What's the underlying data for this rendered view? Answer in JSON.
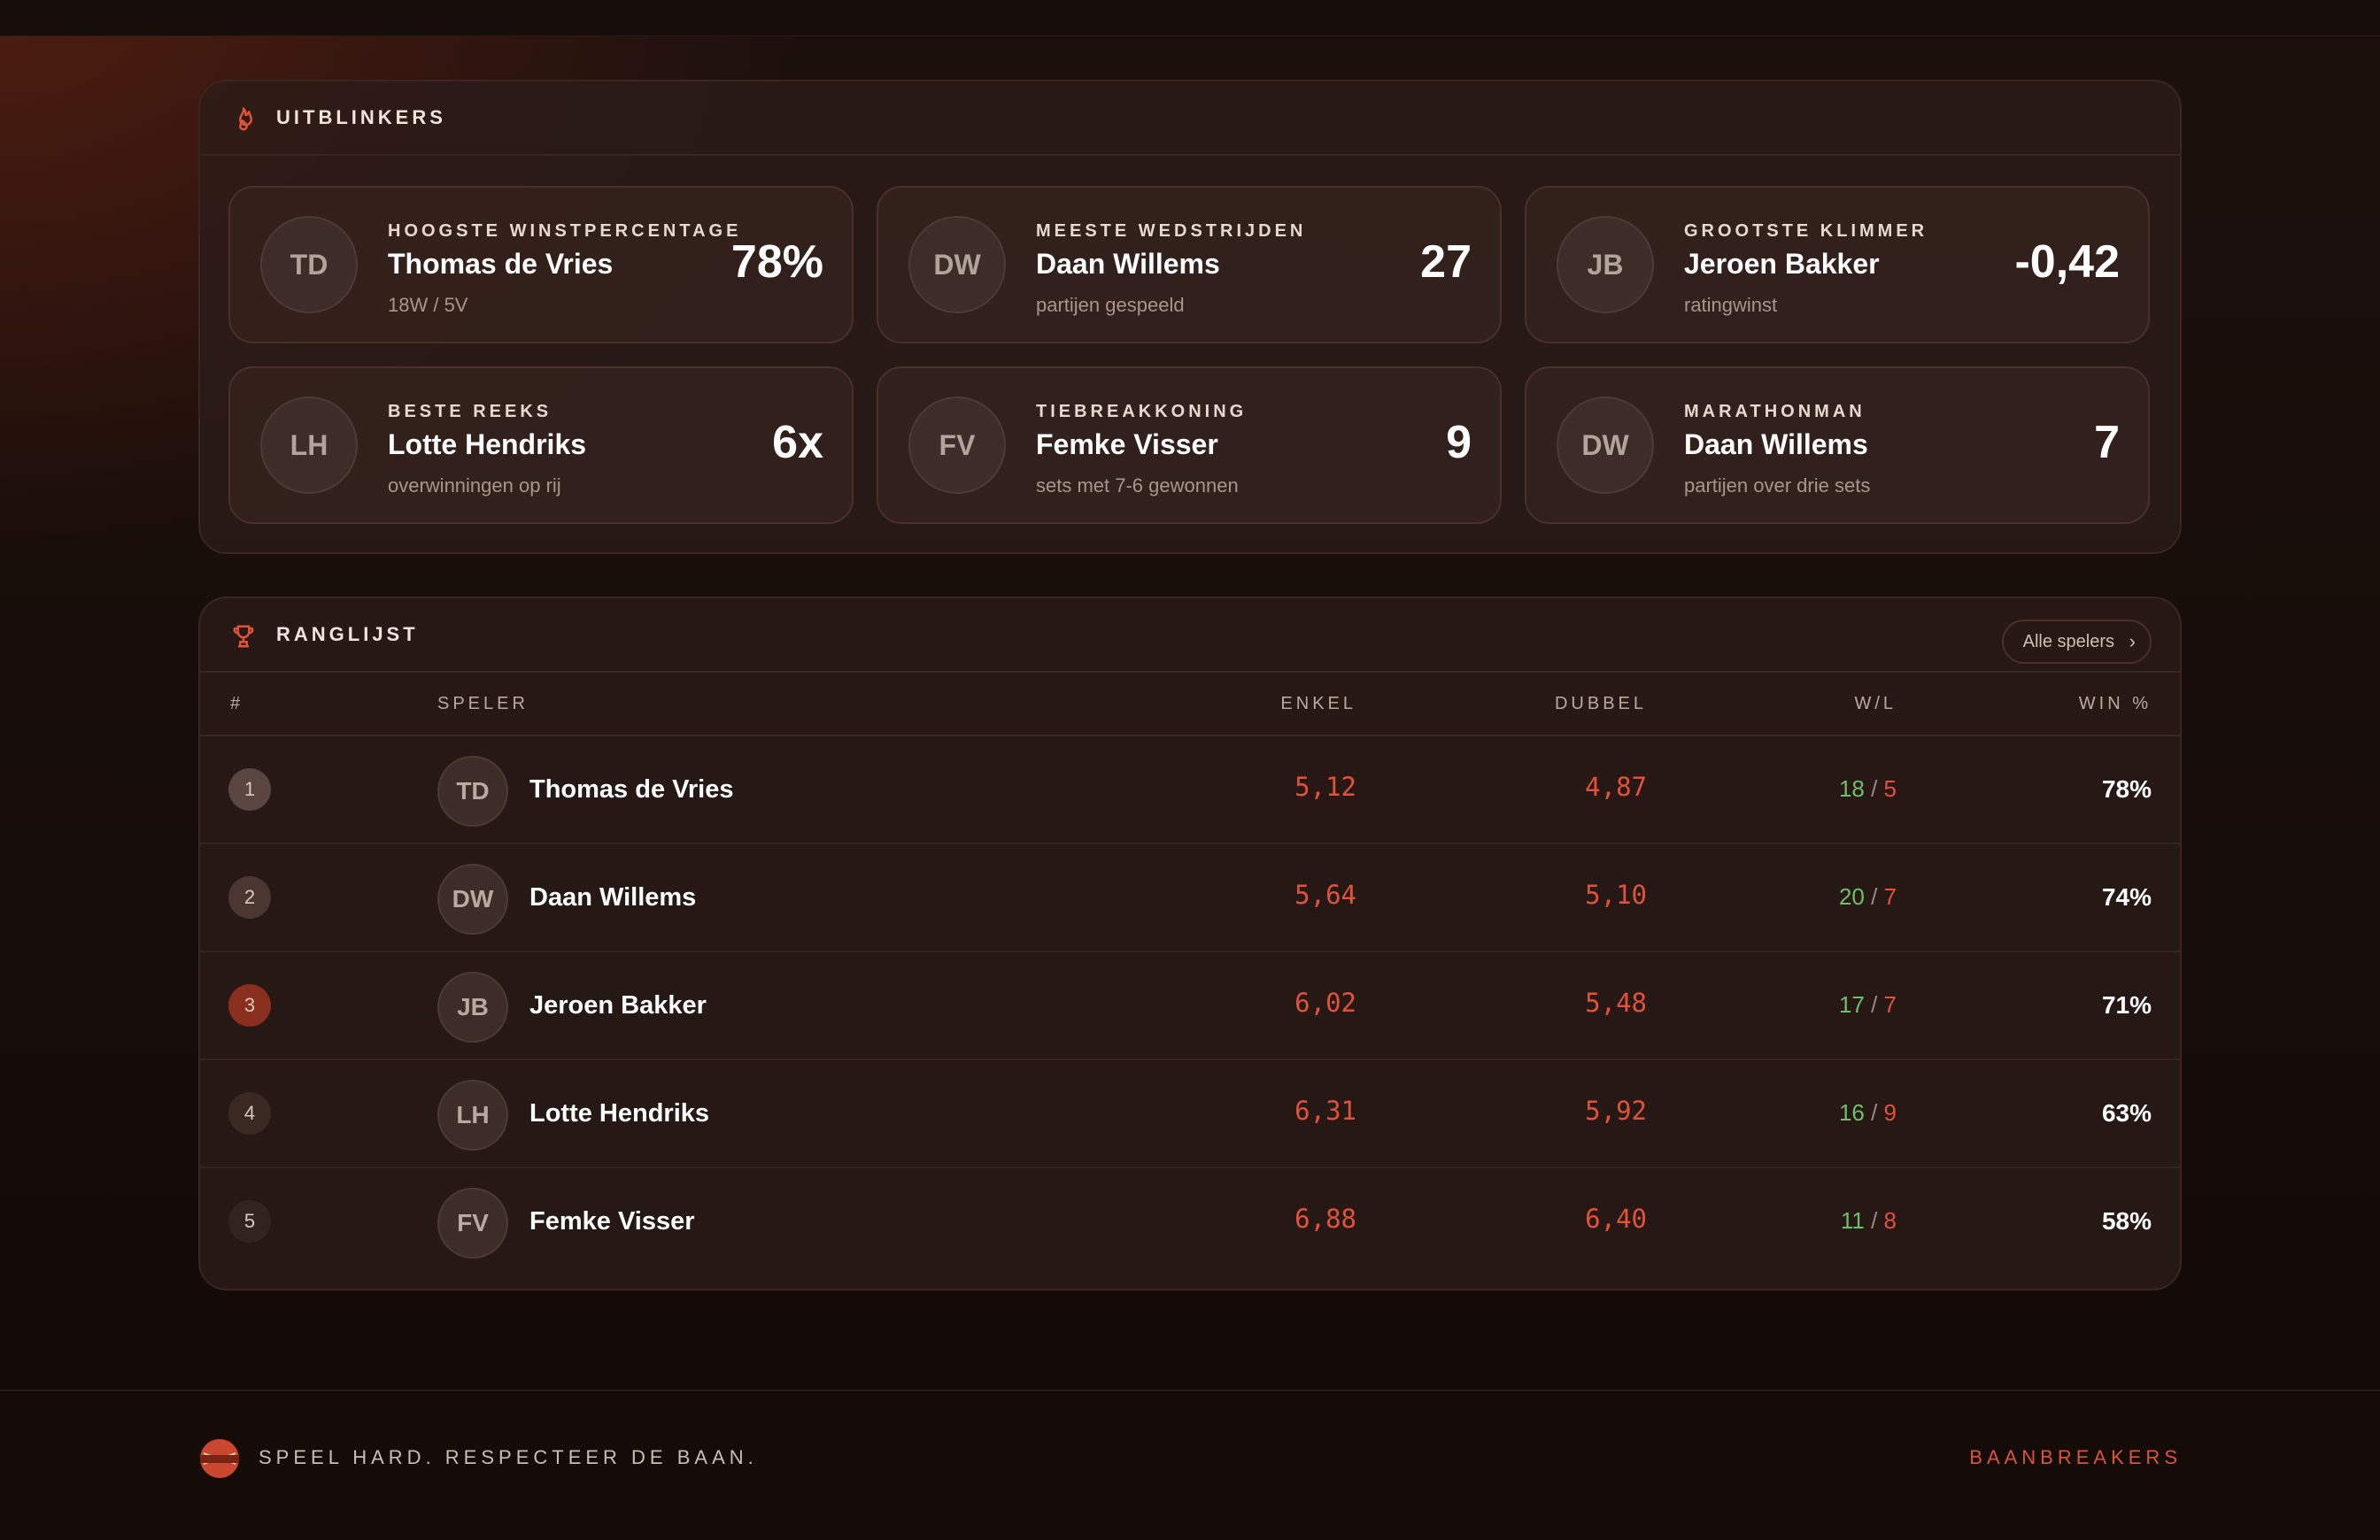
{
  "highlights": {
    "title": "UITBLINKERS",
    "icon": "flame-icon",
    "cards": [
      {
        "initials": "TD",
        "label": "HOOGSTE WINSTPERCENTAGE",
        "name": "Thomas de Vries",
        "sub": "18W / 5V",
        "value": "78%"
      },
      {
        "initials": "DW",
        "label": "MEESTE WEDSTRIJDEN",
        "name": "Daan Willems",
        "sub": "partijen gespeeld",
        "value": "27"
      },
      {
        "initials": "JB",
        "label": "GROOTSTE KLIMMER",
        "name": "Jeroen Bakker",
        "sub": "ratingwinst",
        "value": "-0,42"
      },
      {
        "initials": "LH",
        "label": "BESTE REEKS",
        "name": "Lotte Hendriks",
        "sub": "overwinningen op rij",
        "value": "6x"
      },
      {
        "initials": "FV",
        "label": "TIEBREAKKONING",
        "name": "Femke Visser",
        "sub": "sets met 7-6 gewonnen",
        "value": "9"
      },
      {
        "initials": "DW",
        "label": "MARATHONMAN",
        "name": "Daan Willems",
        "sub": "partijen over drie sets",
        "value": "7"
      }
    ]
  },
  "ranking": {
    "title": "RANGLIJST",
    "icon": "trophy-icon",
    "all_players_label": "Alle spelers",
    "columns": {
      "rank": "#",
      "player": "SPELER",
      "single": "ENKEL",
      "double": "DUBBEL",
      "wl": "W/L",
      "win_pct": "WIN %"
    },
    "rows": [
      {
        "rank": "1",
        "initials": "TD",
        "name": "Thomas de Vries",
        "single": "5,12",
        "double": "4,87",
        "wins": "18",
        "losses": "5",
        "win_pct": "78%"
      },
      {
        "rank": "2",
        "initials": "DW",
        "name": "Daan Willems",
        "single": "5,64",
        "double": "5,10",
        "wins": "20",
        "losses": "7",
        "win_pct": "74%"
      },
      {
        "rank": "3",
        "initials": "JB",
        "name": "Jeroen Bakker",
        "single": "6,02",
        "double": "5,48",
        "wins": "17",
        "losses": "7",
        "win_pct": "71%"
      },
      {
        "rank": "4",
        "initials": "LH",
        "name": "Lotte Hendriks",
        "single": "6,31",
        "double": "5,92",
        "wins": "16",
        "losses": "9",
        "win_pct": "63%"
      },
      {
        "rank": "5",
        "initials": "FV",
        "name": "Femke Visser",
        "single": "6,88",
        "double": "6,40",
        "wins": "11",
        "losses": "8",
        "win_pct": "58%"
      }
    ],
    "rank_badge_colors": [
      "#5a4640",
      "#4a3732",
      "#8a2e1e",
      "#3a2823",
      "#33231f"
    ]
  },
  "footer": {
    "slogan": "SPEEL HARD. RESPECTEER DE BAAN.",
    "brand": "BAANBREAKERS",
    "logo_text": "BAANBREAKERS"
  },
  "colors": {
    "accent": "#e0533a",
    "win": "#6fbf6a",
    "loss": "#e0533a"
  }
}
